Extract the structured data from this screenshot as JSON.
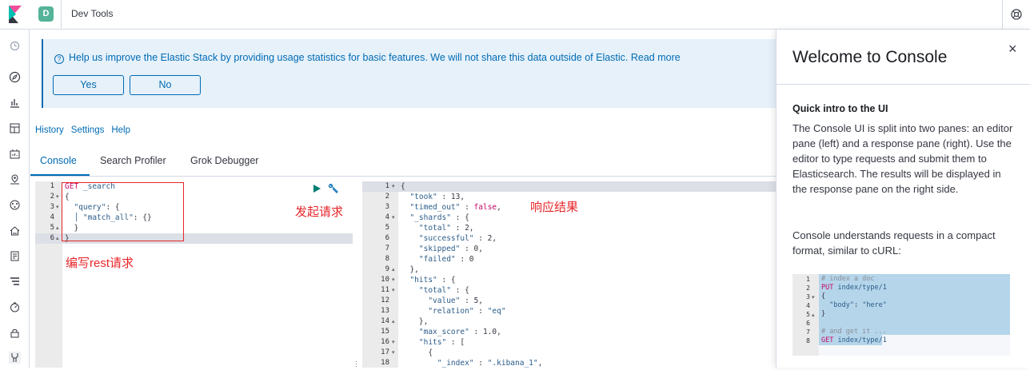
{
  "app": {
    "badge_letter": "D",
    "title": "Dev Tools"
  },
  "callout": {
    "text": "Help us improve the Elastic Stack by providing usage statistics for basic features. We will not share this data outside of Elastic. Read more",
    "yes_label": "Yes",
    "no_label": "No"
  },
  "menu": {
    "history": "History",
    "settings": "Settings",
    "help": "Help"
  },
  "tabs": [
    "Console",
    "Search Profiler",
    "Grok Debugger"
  ],
  "request": {
    "lines": [
      {
        "n": "1",
        "fold": "",
        "text_parts": [
          [
            "GET",
            "get"
          ],
          [
            " _search",
            "str"
          ]
        ]
      },
      {
        "n": "2",
        "fold": "▾",
        "text_parts": [
          [
            "{",
            "punc"
          ]
        ]
      },
      {
        "n": "3",
        "fold": "▾",
        "text_parts": [
          [
            "  \"query\"",
            "str"
          ],
          [
            ": {",
            "punc"
          ]
        ]
      },
      {
        "n": "4",
        "fold": "",
        "text_parts": [
          [
            "  │ \"match_all\"",
            "str"
          ],
          [
            ": {}",
            "punc"
          ]
        ]
      },
      {
        "n": "5",
        "fold": "▴",
        "text_parts": [
          [
            "  }",
            "punc"
          ]
        ]
      },
      {
        "n": "6",
        "fold": "▴",
        "text_parts": [
          [
            "}",
            "punc"
          ]
        ]
      }
    ]
  },
  "annotations": {
    "send_request": "发起请求",
    "write_rest": "编写rest请求",
    "response_result": "响应结果"
  },
  "response": {
    "lines": [
      {
        "n": "1",
        "fold": "▾",
        "text_parts": [
          [
            "{",
            "punc"
          ]
        ]
      },
      {
        "n": "2",
        "fold": "",
        "text_parts": [
          [
            "  \"took\"",
            "str"
          ],
          [
            " : 13,",
            "punc"
          ]
        ]
      },
      {
        "n": "3",
        "fold": "",
        "text_parts": [
          [
            "  \"timed_out\"",
            "str"
          ],
          [
            " : ",
            "punc"
          ],
          [
            "false",
            "bool"
          ],
          [
            ",",
            "punc"
          ]
        ]
      },
      {
        "n": "4",
        "fold": "▾",
        "text_parts": [
          [
            "  \"_shards\"",
            "str"
          ],
          [
            " : {",
            "punc"
          ]
        ]
      },
      {
        "n": "5",
        "fold": "",
        "text_parts": [
          [
            "    \"total\"",
            "str"
          ],
          [
            " : 2,",
            "punc"
          ]
        ]
      },
      {
        "n": "6",
        "fold": "",
        "text_parts": [
          [
            "    \"successful\"",
            "str"
          ],
          [
            " : 2,",
            "punc"
          ]
        ]
      },
      {
        "n": "7",
        "fold": "",
        "text_parts": [
          [
            "    \"skipped\"",
            "str"
          ],
          [
            " : 0,",
            "punc"
          ]
        ]
      },
      {
        "n": "8",
        "fold": "",
        "text_parts": [
          [
            "    \"failed\"",
            "str"
          ],
          [
            " : 0",
            "punc"
          ]
        ]
      },
      {
        "n": "9",
        "fold": "▴",
        "text_parts": [
          [
            "  },",
            "punc"
          ]
        ]
      },
      {
        "n": "10",
        "fold": "▾",
        "text_parts": [
          [
            "  \"hits\"",
            "str"
          ],
          [
            " : {",
            "punc"
          ]
        ]
      },
      {
        "n": "11",
        "fold": "▾",
        "text_parts": [
          [
            "    \"total\"",
            "str"
          ],
          [
            " : {",
            "punc"
          ]
        ]
      },
      {
        "n": "12",
        "fold": "",
        "text_parts": [
          [
            "      \"value\"",
            "str"
          ],
          [
            " : 5,",
            "punc"
          ]
        ]
      },
      {
        "n": "13",
        "fold": "",
        "text_parts": [
          [
            "      \"relation\"",
            "str"
          ],
          [
            " : ",
            "punc"
          ],
          [
            "\"eq\"",
            "str"
          ]
        ]
      },
      {
        "n": "14",
        "fold": "▴",
        "text_parts": [
          [
            "    },",
            "punc"
          ]
        ]
      },
      {
        "n": "15",
        "fold": "",
        "text_parts": [
          [
            "    \"max_score\"",
            "str"
          ],
          [
            " : 1.0,",
            "punc"
          ]
        ]
      },
      {
        "n": "16",
        "fold": "▾",
        "text_parts": [
          [
            "    \"hits\"",
            "str"
          ],
          [
            " : [",
            "punc"
          ]
        ]
      },
      {
        "n": "17",
        "fold": "▾",
        "text_parts": [
          [
            "      {",
            "punc"
          ]
        ]
      },
      {
        "n": "18",
        "fold": "",
        "text_parts": [
          [
            "        \"_index\"",
            "str"
          ],
          [
            " : ",
            "punc"
          ],
          [
            "\".kibana_1\"",
            "str"
          ],
          [
            ",",
            "punc"
          ]
        ]
      }
    ]
  },
  "flyout": {
    "title": "Welcome to Console",
    "heading": "Quick intro to the UI",
    "para1": "The Console UI is split into two panes: an editor pane (left) and a response pane (right). Use the editor to type requests and submit them to Elasticsearch. The results will be displayed in the response pane on the right side.",
    "para2": "Console understands requests in a compact format, similar to cURL:",
    "example_lines": [
      {
        "n": "1",
        "fold": "",
        "text_parts": [
          [
            "# index a doc",
            "comment"
          ]
        ]
      },
      {
        "n": "2",
        "fold": "",
        "text_parts": [
          [
            "PUT",
            "get"
          ],
          [
            " index/type/1",
            "str"
          ]
        ]
      },
      {
        "n": "3",
        "fold": "▾",
        "text_parts": [
          [
            "{",
            "punc"
          ]
        ]
      },
      {
        "n": "4",
        "fold": "",
        "text_parts": [
          [
            "  \"body\"",
            "str"
          ],
          [
            ": ",
            "punc"
          ],
          [
            "\"here\"",
            "str"
          ]
        ]
      },
      {
        "n": "5",
        "fold": "▴",
        "text_parts": [
          [
            "}",
            "punc"
          ]
        ]
      },
      {
        "n": "6",
        "fold": "",
        "text_parts": [
          [
            "",
            "punc"
          ]
        ]
      },
      {
        "n": "7",
        "fold": "",
        "text_parts": [
          [
            "# and get it ...",
            "comment"
          ]
        ]
      },
      {
        "n": "8",
        "fold": "",
        "text_parts": [
          [
            "GET",
            "get"
          ],
          [
            " index/type/1",
            "str"
          ]
        ]
      }
    ]
  },
  "colors": {
    "accent": "#006bb4",
    "annotation_red": "#e7262a",
    "badge_green": "#54b399",
    "keyword_pink": "#c80a68"
  }
}
